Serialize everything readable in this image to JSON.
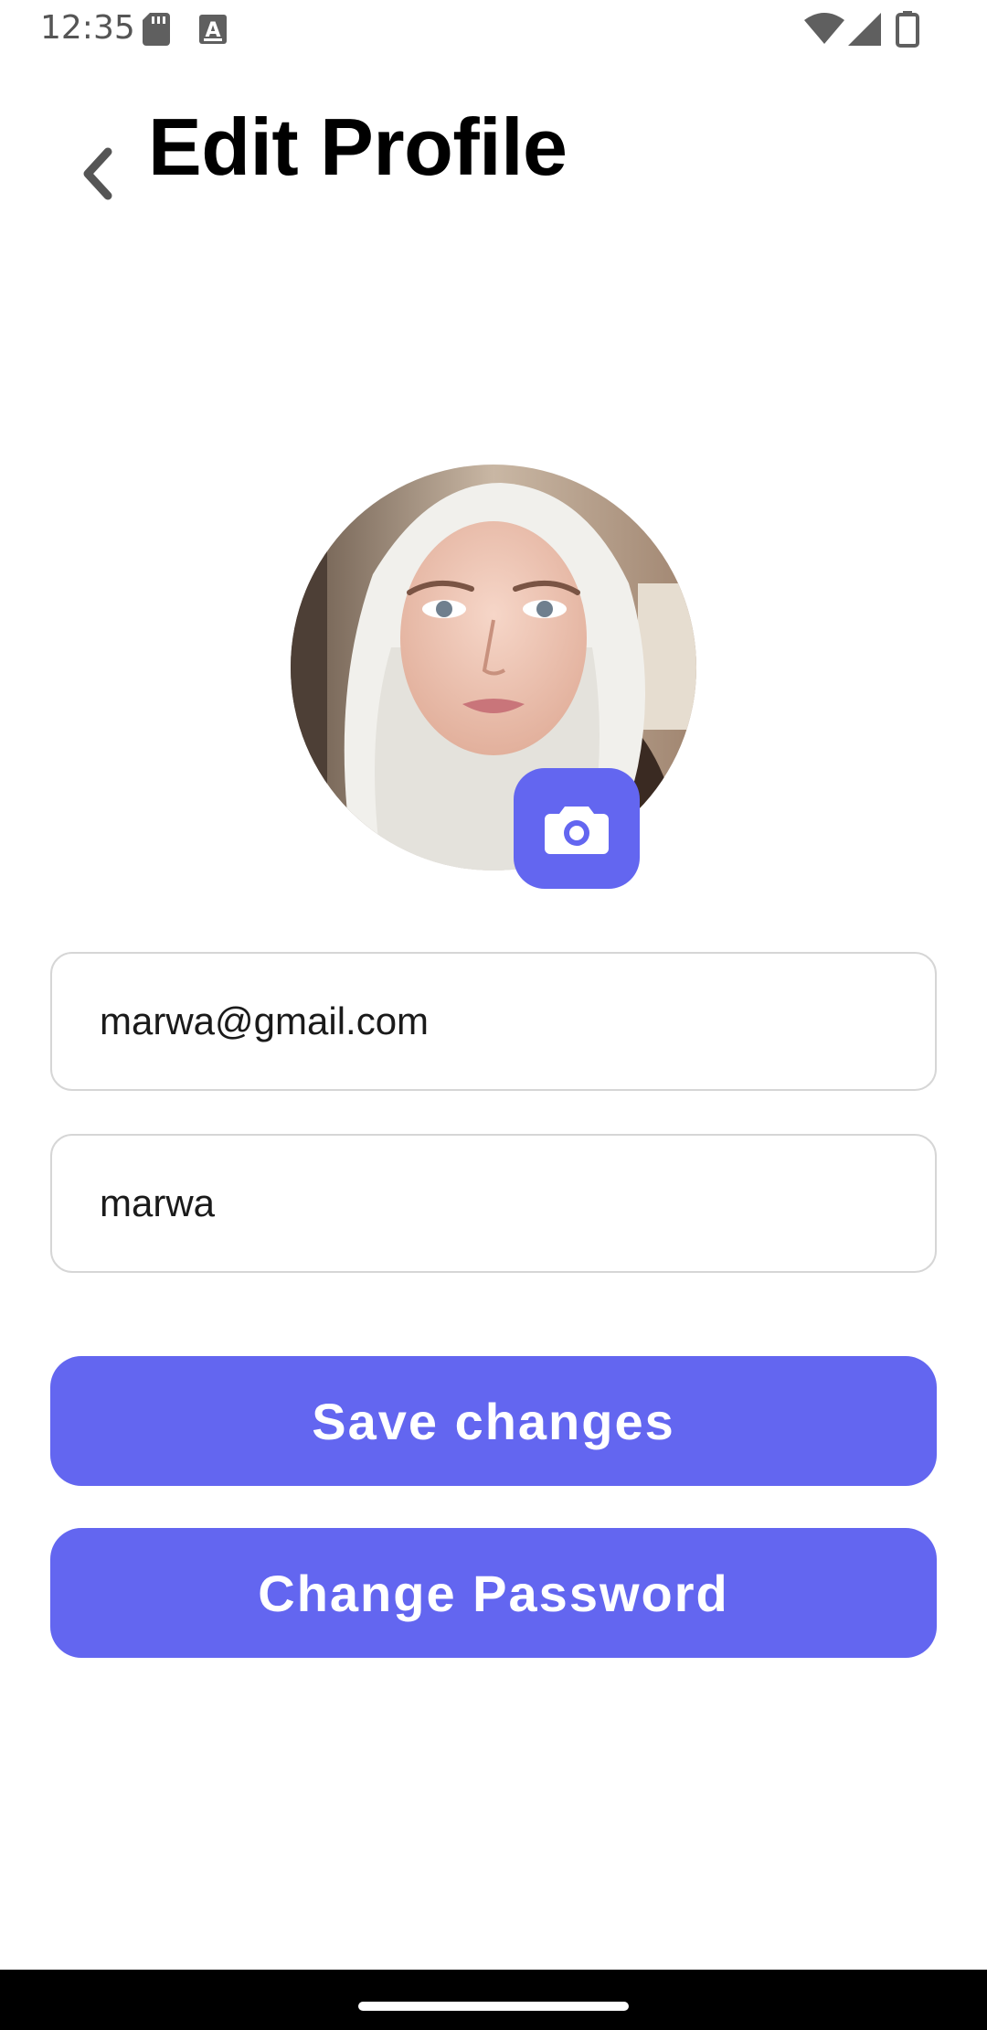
{
  "status_bar": {
    "time": "12:35",
    "icons": [
      "sd-card-icon",
      "a-notification-icon",
      "wifi-icon",
      "signal-icon",
      "battery-icon"
    ]
  },
  "header": {
    "title": "Edit Profile",
    "back_icon": "chevron-left-icon"
  },
  "profile": {
    "avatar": "profile-photo",
    "camera_icon": "camera-icon"
  },
  "form": {
    "email_value": "marwa@gmail.com",
    "name_value": "marwa"
  },
  "actions": {
    "save_label": "Save changes",
    "change_password_label": "Change Password"
  },
  "colors": {
    "accent": "#6366f0",
    "field_border": "#d6d6d6",
    "background": "#ffffff"
  }
}
